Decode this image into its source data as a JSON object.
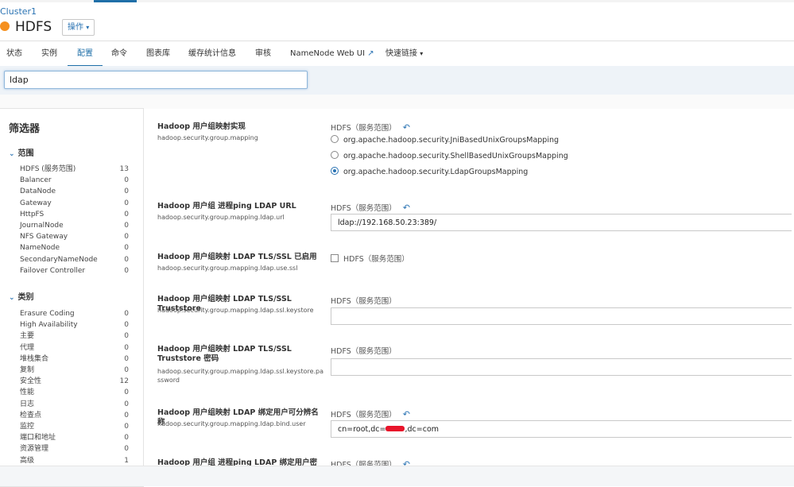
{
  "header": {
    "cluster": "Cluster1",
    "service": "HDFS",
    "actions_label": "操作",
    "caret": "▾"
  },
  "colors": {
    "accent": "#1f6fa8",
    "status_dot": "#f5901e",
    "link": "#2a73b3"
  },
  "tabs": [
    "状态",
    "实例",
    "配置",
    "命令",
    "图表库",
    "缓存统计信息",
    "审核",
    "NameNode Web UI",
    "快速链接"
  ],
  "active_tab": "配置",
  "tab_icons": {
    "external": "↗",
    "dropdown": "▾"
  },
  "search": {
    "value": "ldap"
  },
  "filters": {
    "title": "筛选器",
    "chevron": "⌄",
    "scope": {
      "heading": "范围",
      "items": [
        {
          "label": "HDFS (服务范围)",
          "count": "13"
        },
        {
          "label": "Balancer",
          "count": "0"
        },
        {
          "label": "DataNode",
          "count": "0"
        },
        {
          "label": "Gateway",
          "count": "0"
        },
        {
          "label": "HttpFS",
          "count": "0"
        },
        {
          "label": "JournalNode",
          "count": "0"
        },
        {
          "label": "NFS Gateway",
          "count": "0"
        },
        {
          "label": "NameNode",
          "count": "0"
        },
        {
          "label": "SecondaryNameNode",
          "count": "0"
        },
        {
          "label": "Failover Controller",
          "count": "0"
        }
      ]
    },
    "category": {
      "heading": "类别",
      "items": [
        {
          "label": "Erasure Coding",
          "count": "0"
        },
        {
          "label": "High Availability",
          "count": "0"
        },
        {
          "label": "主要",
          "count": "0"
        },
        {
          "label": "代理",
          "count": "0"
        },
        {
          "label": "堆栈集合",
          "count": "0"
        },
        {
          "label": "复制",
          "count": "0"
        },
        {
          "label": "安全性",
          "count": "12"
        },
        {
          "label": "性能",
          "count": "0"
        },
        {
          "label": "日志",
          "count": "0"
        },
        {
          "label": "检查点",
          "count": "0"
        },
        {
          "label": "监控",
          "count": "0"
        },
        {
          "label": "端口和地址",
          "count": "0"
        },
        {
          "label": "资源管理",
          "count": "0"
        },
        {
          "label": "高级",
          "count": "1"
        }
      ]
    }
  },
  "undo_icon": "↶",
  "properties": {
    "mapping": {
      "title": "Hadoop 用户组映射实现",
      "key": "hadoop.security.group.mapping",
      "scope": "HDFS（服务范围）",
      "options": [
        "org.apache.hadoop.security.JniBasedUnixGroupsMapping",
        "org.apache.hadoop.security.ShellBasedUnixGroupsMapping",
        "org.apache.hadoop.security.LdapGroupsMapping"
      ],
      "selected_index": 2
    },
    "url": {
      "title": "Hadoop 用户组 进程ping LDAP URL",
      "key": "hadoop.security.group.mapping.ldap.url",
      "scope": "HDFS（服务范围）",
      "value": "ldap://192.168.50.23:389/"
    },
    "use_ssl": {
      "title": "Hadoop 用户组映射 LDAP TLS/SSL 已启用",
      "key": "hadoop.security.group.mapping.ldap.use.ssl",
      "scope": "HDFS（服务范围）",
      "checked": false
    },
    "keystore": {
      "title": "Hadoop 用户组映射 LDAP TLS/SSL Truststore",
      "key": "hadoop.security.group.mapping.ldap.ssl.keystore",
      "scope": "HDFS（服务范围）",
      "value": ""
    },
    "keystore_password": {
      "title": "Hadoop 用户组映射 LDAP TLS/SSL Truststore 密码",
      "key": "hadoop.security.group.mapping.ldap.ssl.keystore.password",
      "scope": "HDFS（服务范围）",
      "value": ""
    },
    "bind_user": {
      "title": "Hadoop 用户组映射 LDAP 绑定用户可分辨名称",
      "key": "hadoop.security.group.mapping.ldap.bind.user",
      "scope": "HDFS（服务范围）",
      "value_prefix": "cn=root,dc=",
      "value_suffix": ",dc=com"
    },
    "bind_password": {
      "title": "Hadoop 用户组 进程ping LDAP 绑定用户密码",
      "scope": "HDFS（服务范围）"
    }
  }
}
